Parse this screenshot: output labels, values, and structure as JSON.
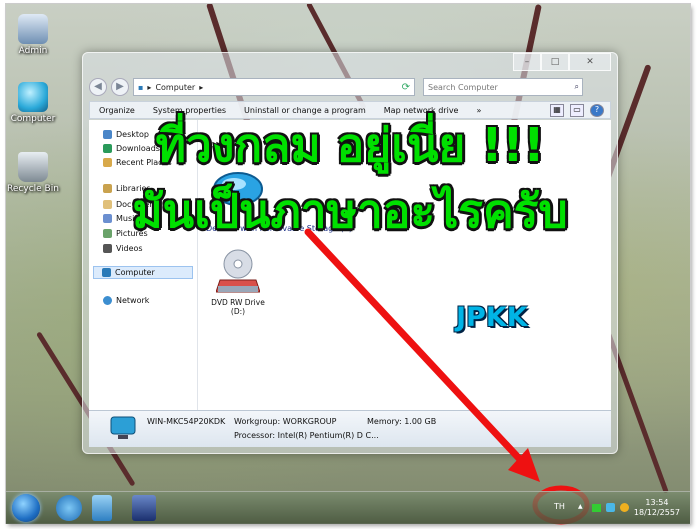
{
  "desktop": {
    "icons": [
      {
        "label": "Admin"
      },
      {
        "label": "Computer"
      },
      {
        "label": "Recycle Bin"
      }
    ]
  },
  "window": {
    "address": {
      "segments": [
        "Computer"
      ]
    },
    "search_placeholder": "Search Computer",
    "toolbar": {
      "items": [
        "Organize",
        "System properties",
        "Uninstall or change a program",
        "Map network drive"
      ],
      "more": "»"
    },
    "nav_pane": {
      "items": [
        "Desktop",
        "Downloads",
        "Recent Places",
        "Libraries",
        "Documents",
        "Music",
        "Pictures",
        "Videos",
        "Computer",
        "Network"
      ]
    },
    "content": {
      "group_heading": "Devices with Removable Storage (1)",
      "drive": {
        "name": "DVD RW Drive",
        "letter": "(D:)"
      }
    },
    "details": {
      "computer_name": "WIN-MKC54P20KDK",
      "workgroup": "Workgroup: WORKGROUP",
      "memory": "Memory: 1.00 GB",
      "processor": "Processor: Intel(R) Pentium(R) D C..."
    }
  },
  "overlay": {
    "line1": "ที่วงกลม อยู่เนี่ย !!!",
    "line2": "มันเป็นภาษาอะไรครับ",
    "watermark": "JPKK",
    "colors": {
      "text": "#00e000",
      "arrow": "#ee1111",
      "circle": "#ee1111",
      "watermark": "#00b4e6"
    }
  },
  "taskbar": {
    "language": "TH",
    "tray_arrow": "▲",
    "time": "13:54",
    "date": "18/12/2557"
  }
}
